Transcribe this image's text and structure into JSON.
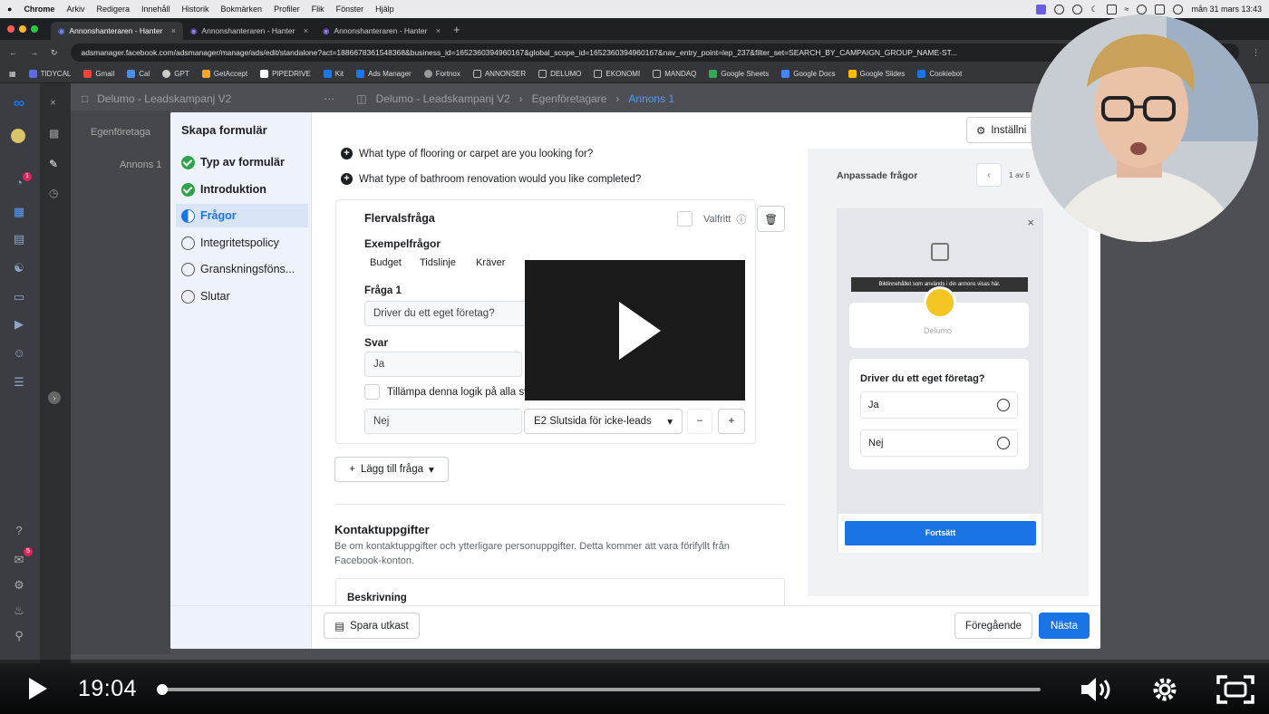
{
  "menubar": {
    "app": "Chrome",
    "items": [
      "Arkiv",
      "Redigera",
      "Innehåll",
      "Historik",
      "Bokmärken",
      "Profiler",
      "Flik",
      "Fönster",
      "Hjälp"
    ],
    "clock": "mån 31 mars 13:43"
  },
  "tabs": [
    {
      "label": "Annonshanteraren - Hanter"
    },
    {
      "label": "Annonshanteraren - Hanter"
    },
    {
      "label": "Annonshanteraren - Hanter"
    }
  ],
  "address": {
    "url": "adsmanager.facebook.com/adsmanager/manage/ads/edit/standalone?act=1886678361548368&business_id=1652360394960167&global_scope_id=1652360394960167&nav_entry_point=lep_237&filter_set=SEARCH_BY_CAMPAIGN_GROUP_NAME-ST..."
  },
  "bookmarks": [
    {
      "label": "TIDYCAL",
      "color": "#5b6dd8"
    },
    {
      "label": "Gmail",
      "color": "#e8453c"
    },
    {
      "label": "Cal",
      "color": "#4a90e2"
    },
    {
      "label": "GPT",
      "color": "#cccccc"
    },
    {
      "label": "GetAccept",
      "color": "#f5a623"
    },
    {
      "label": "PIPEDRIVE",
      "color": "#ffffff"
    },
    {
      "label": "Kit",
      "color": "#1877f2"
    },
    {
      "label": "Ads Manager",
      "color": "#1877f2"
    },
    {
      "label": "Fortnox",
      "color": "#999999"
    },
    {
      "label": "ANNONSER",
      "color": "#999999"
    },
    {
      "label": "DELUMO",
      "color": "#999999"
    },
    {
      "label": "EKONOMI",
      "color": "#999999"
    },
    {
      "label": "MANDAQ",
      "color": "#999999"
    },
    {
      "label": "Google Sheets",
      "color": "#34a853"
    },
    {
      "label": "Google Docs",
      "color": "#4285f4"
    },
    {
      "label": "Google Slides",
      "color": "#fbbc04"
    },
    {
      "label": "Cookiebot",
      "color": "#1a73e8"
    }
  ],
  "background": {
    "campaign": "Delumo - Leadskampanj V2",
    "breadcrumb": [
      "Delumo - Leadskampanj V2",
      "Egenföretagare",
      "Annons 1"
    ],
    "adset": "Egenföretaga",
    "ad": "Annons 1",
    "badge1": "1",
    "badge2": "5"
  },
  "modal": {
    "title": "Skapa formulär",
    "steps": [
      {
        "label": "Typ av formulär",
        "state": "done"
      },
      {
        "label": "Introduktion",
        "state": "done"
      },
      {
        "label": "Frågor",
        "state": "active"
      },
      {
        "label": "Integritetspolicy",
        "state": "empty"
      },
      {
        "label": "Granskningsföns...",
        "state": "empty"
      },
      {
        "label": "Slutar",
        "state": "empty"
      }
    ],
    "questions": [
      "What type of flooring or carpet are you looking for?",
      "What type of bathroom renovation would you like completed?"
    ],
    "card": {
      "title": "Flervalsfråga",
      "optional": "Valfritt",
      "examples_label": "Exempelfrågor",
      "examples": [
        "Budget",
        "Tidslinje",
        "Kräver"
      ],
      "question_label": "Fråga 1",
      "question_value": "Driver du ett eget företag?",
      "answers_label": "Svar",
      "answer1": "Ja",
      "apply_logic": "Tillämpa denna logik på alla sv",
      "answer2": "Nej",
      "answer2_dest": "E2 Slutsida för icke-leads"
    },
    "add_question": "Lägg till fråga",
    "contact": {
      "title": "Kontaktuppgifter",
      "desc": "Be om kontaktuppgifter och ytterligare personuppgifter. Detta kommer att vara förifyllt från Facebook-konton.",
      "sub": "Beskrivning"
    },
    "save_draft": "Spara utkast",
    "prev": "Föregående",
    "next": "Nästa",
    "settings": "Inställni",
    "preview": {
      "section": "Anpassade frågor",
      "pager": "1 av 5",
      "tooltip": "Bildinnehållet som används i din annons visas här.",
      "brand": "Delumo",
      "question": "Driver du ett eget företag?",
      "options": [
        "Ja",
        "Nej"
      ],
      "continue": "Fortsätt"
    }
  },
  "video": {
    "time": "19:04",
    "progress": 0.003
  }
}
